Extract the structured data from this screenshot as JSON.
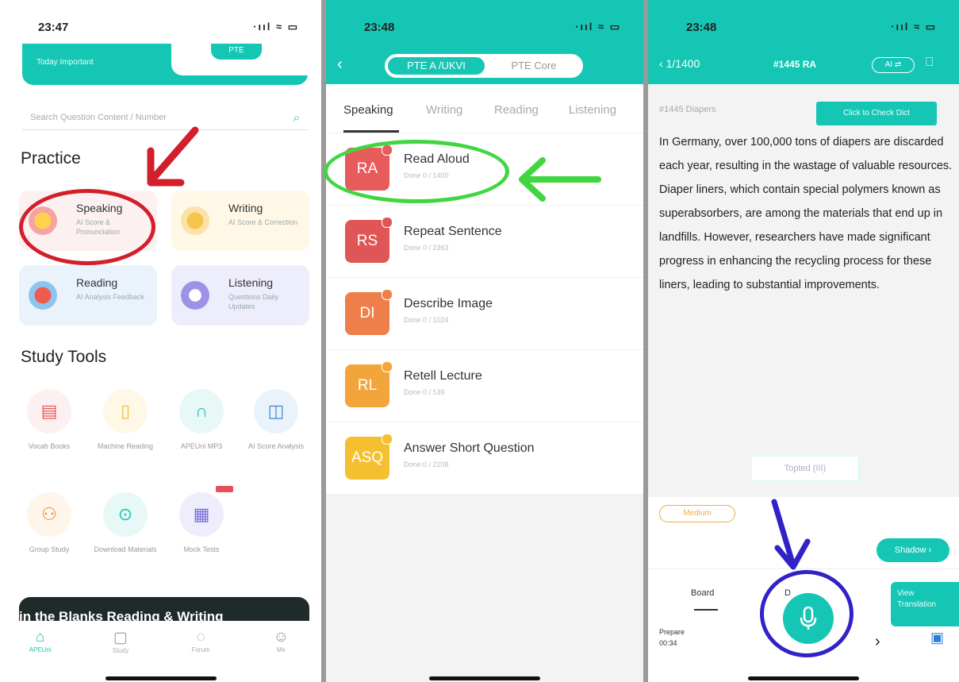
{
  "colors": {
    "teal": "#16c6b4",
    "red": "#d21f2b",
    "green": "#3fd63f",
    "blue": "#3122c8"
  },
  "panel1": {
    "status_time": "23:47",
    "status_icons": "·ııl ≈ ▭",
    "top_card_text": "Today Important",
    "top_card_pill": "PTE",
    "search_placeholder": "Search Question Content / Number",
    "practice_heading": "Practice",
    "cards": [
      {
        "title": "Speaking",
        "sub": "AI Score & Pronunciation",
        "icon": "speaking-icon"
      },
      {
        "title": "Writing",
        "sub": "AI Score & Correction",
        "icon": "writing-icon"
      },
      {
        "title": "Reading",
        "sub": "AI Analysis Feedback",
        "icon": "reading-icon"
      },
      {
        "title": "Listening",
        "sub": "Questions Daily Updates",
        "icon": "listening-icon"
      }
    ],
    "study_heading": "Study Tools",
    "tools": [
      {
        "label": "Vocab Books",
        "icon": "vocab-icon"
      },
      {
        "label": "Machine Reading",
        "icon": "machine-reading-icon"
      },
      {
        "label": "APEUni MP3",
        "icon": "headphones-icon"
      },
      {
        "label": "AI Score Analysis",
        "icon": "analysis-icon"
      },
      {
        "label": "Group Study",
        "icon": "group-icon"
      },
      {
        "label": "Download Materials",
        "icon": "download-icon"
      },
      {
        "label": "Mock Tests",
        "icon": "mock-test-icon"
      }
    ],
    "banner_text": "in the Blanks Reading & Writing",
    "tabbar": [
      {
        "label": "APEUni",
        "icon": "home-icon"
      },
      {
        "label": "Study",
        "icon": "study-icon"
      },
      {
        "label": "Forum",
        "icon": "forum-icon"
      },
      {
        "label": "Me",
        "icon": "me-icon"
      }
    ]
  },
  "panel2": {
    "status_time": "23:48",
    "status_icons": "·ııl ≈ ▭",
    "toggle_left": "PTE A /UKVI",
    "toggle_right": "PTE Core",
    "tabs": [
      "Speaking",
      "Writing",
      "Reading",
      "Listening"
    ],
    "items": [
      {
        "abbr": "RA",
        "title": "Read Aloud",
        "sub": "Done 0 / 1400",
        "color": "#e85b5b"
      },
      {
        "abbr": "RS",
        "title": "Repeat Sentence",
        "sub": "Done 0 / 2363",
        "color": "#e05656"
      },
      {
        "abbr": "DI",
        "title": "Describe Image",
        "sub": "Done 0 / 1024",
        "color": "#ef7f4a"
      },
      {
        "abbr": "RL",
        "title": "Retell Lecture",
        "sub": "Done 0 / 539",
        "color": "#f2a53a"
      },
      {
        "abbr": "ASQ",
        "title": "Answer Short Question",
        "sub": "Done 0 / 2208",
        "color": "#f5c02f"
      }
    ]
  },
  "panel3": {
    "status_time": "23:48",
    "status_icons": "·ııl ≈ ▭",
    "back_label": "1/1400",
    "header_title": "#1445 RA",
    "header_button": "AI ⇄",
    "question_id": "#1445 Diapers",
    "check_button": "Click to Check Dict",
    "passage": "In Germany, over 100,000 tons of diapers are discarded each year, resulting in the wastage of valuable resources. Diaper liners, which contain special polymers known as superabsorbers, are among the materials that end up in landfills. However, researchers have made significant progress in enhancing the recycling process for these liners, leading to substantial improvements.",
    "tag_button": "Topted (III)",
    "difficulty": "Medium",
    "shadow_button": "Shadow ›",
    "board_tab": "Board",
    "second_tab": "D",
    "view_translation": "View Translation",
    "prepare_label": "Prepare",
    "prepare_time": "00:34"
  }
}
